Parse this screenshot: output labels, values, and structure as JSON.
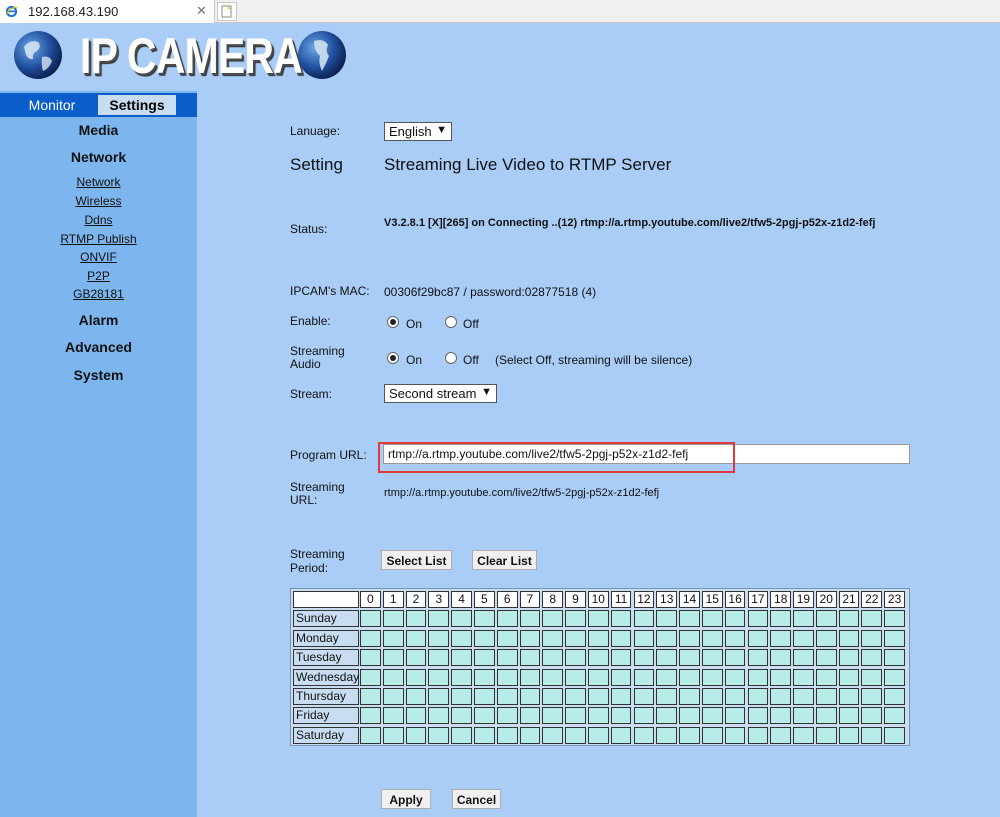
{
  "browser": {
    "tab_title": "192.168.43.190",
    "close_glyph": "✕"
  },
  "header": {
    "brand": "IP CAMERA"
  },
  "sidebar": {
    "tabs": [
      "Monitor",
      "Settings"
    ],
    "groups_top": [
      "Media",
      "Network"
    ],
    "network_links": [
      "Network",
      "Wireless",
      "Ddns",
      "RTMP Publish",
      "ONVIF",
      "P2P",
      "GB28181"
    ],
    "groups_bottom": [
      "Alarm",
      "Advanced",
      "System"
    ]
  },
  "form": {
    "language_label": "Lanuage:",
    "language_value": "English",
    "setting_label": "Setting",
    "setting_title": "Streaming Live Video to RTMP Server",
    "status_label": "Status:",
    "status_value": "V3.2.8.1 [X][265] on Connecting ..(12) rtmp://a.rtmp.youtube.com/live2/tfw5-2pgj-p52x-z1d2-fefj",
    "mac_label": "IPCAM's MAC:",
    "mac_value": "00306f29bc87 / password:02877518 (4)",
    "enable_label": "Enable:",
    "on_label": "On",
    "off_label": "Off",
    "audio_label_1": "Streaming",
    "audio_label_2": "Audio",
    "audio_note": "(Select Off, streaming will be silence)",
    "stream_label": "Stream:",
    "stream_value": "Second stream",
    "program_url_label": "Program URL:",
    "program_url_value": "rtmp://a.rtmp.youtube.com/live2/tfw5-2pgj-p52x-z1d2-fefj",
    "streaming_url_label_1": "Streaming",
    "streaming_url_label_2": "URL:",
    "streaming_url_value": "rtmp://a.rtmp.youtube.com/live2/tfw5-2pgj-p52x-z1d2-fefj",
    "period_label_1": "Streaming",
    "period_label_2": "Period:",
    "select_list": "Select List",
    "clear_list": "Clear List",
    "apply": "Apply",
    "cancel": "Cancel"
  },
  "schedule": {
    "hours": [
      "0",
      "1",
      "2",
      "3",
      "4",
      "5",
      "6",
      "7",
      "8",
      "9",
      "10",
      "11",
      "12",
      "13",
      "14",
      "15",
      "16",
      "17",
      "18",
      "19",
      "20",
      "21",
      "22",
      "23"
    ],
    "days": [
      "Sunday",
      "Monday",
      "Tuesday",
      "Wednesday",
      "Thursday",
      "Friday",
      "Saturday"
    ]
  },
  "colors": {
    "accent": "#0b5ec9",
    "sidebar": "#7db6ee",
    "background": "#a9cdf6",
    "cell": "#b8ece8",
    "highlight": "#e0393b"
  }
}
